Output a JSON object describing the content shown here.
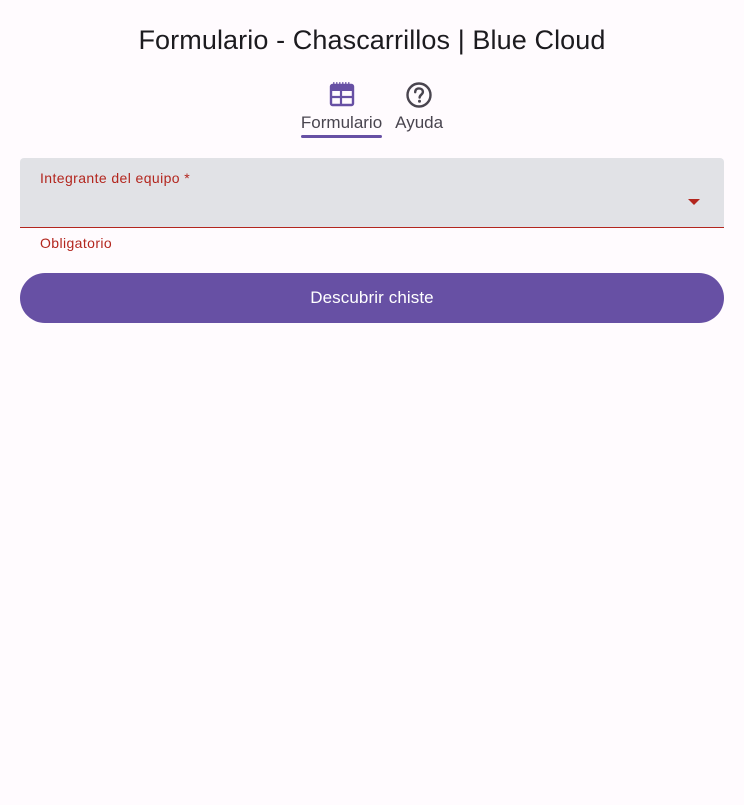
{
  "app": {
    "title": "Formulario - Chascarrillos | Blue Cloud"
  },
  "tabs": [
    {
      "label": "Formulario",
      "icon": "table-icon",
      "active": true
    },
    {
      "label": "Ayuda",
      "icon": "help-circle-icon",
      "active": false
    }
  ],
  "form": {
    "member_field": {
      "label": "Integrante del equipo *",
      "value": "",
      "error": "Obligatorio"
    },
    "submit_label": "Descubrir chiste"
  },
  "colors": {
    "primary": "#6750A4",
    "error": "#B3261E",
    "field_background": "#E1E2E6",
    "background": "#FFFBFE"
  }
}
